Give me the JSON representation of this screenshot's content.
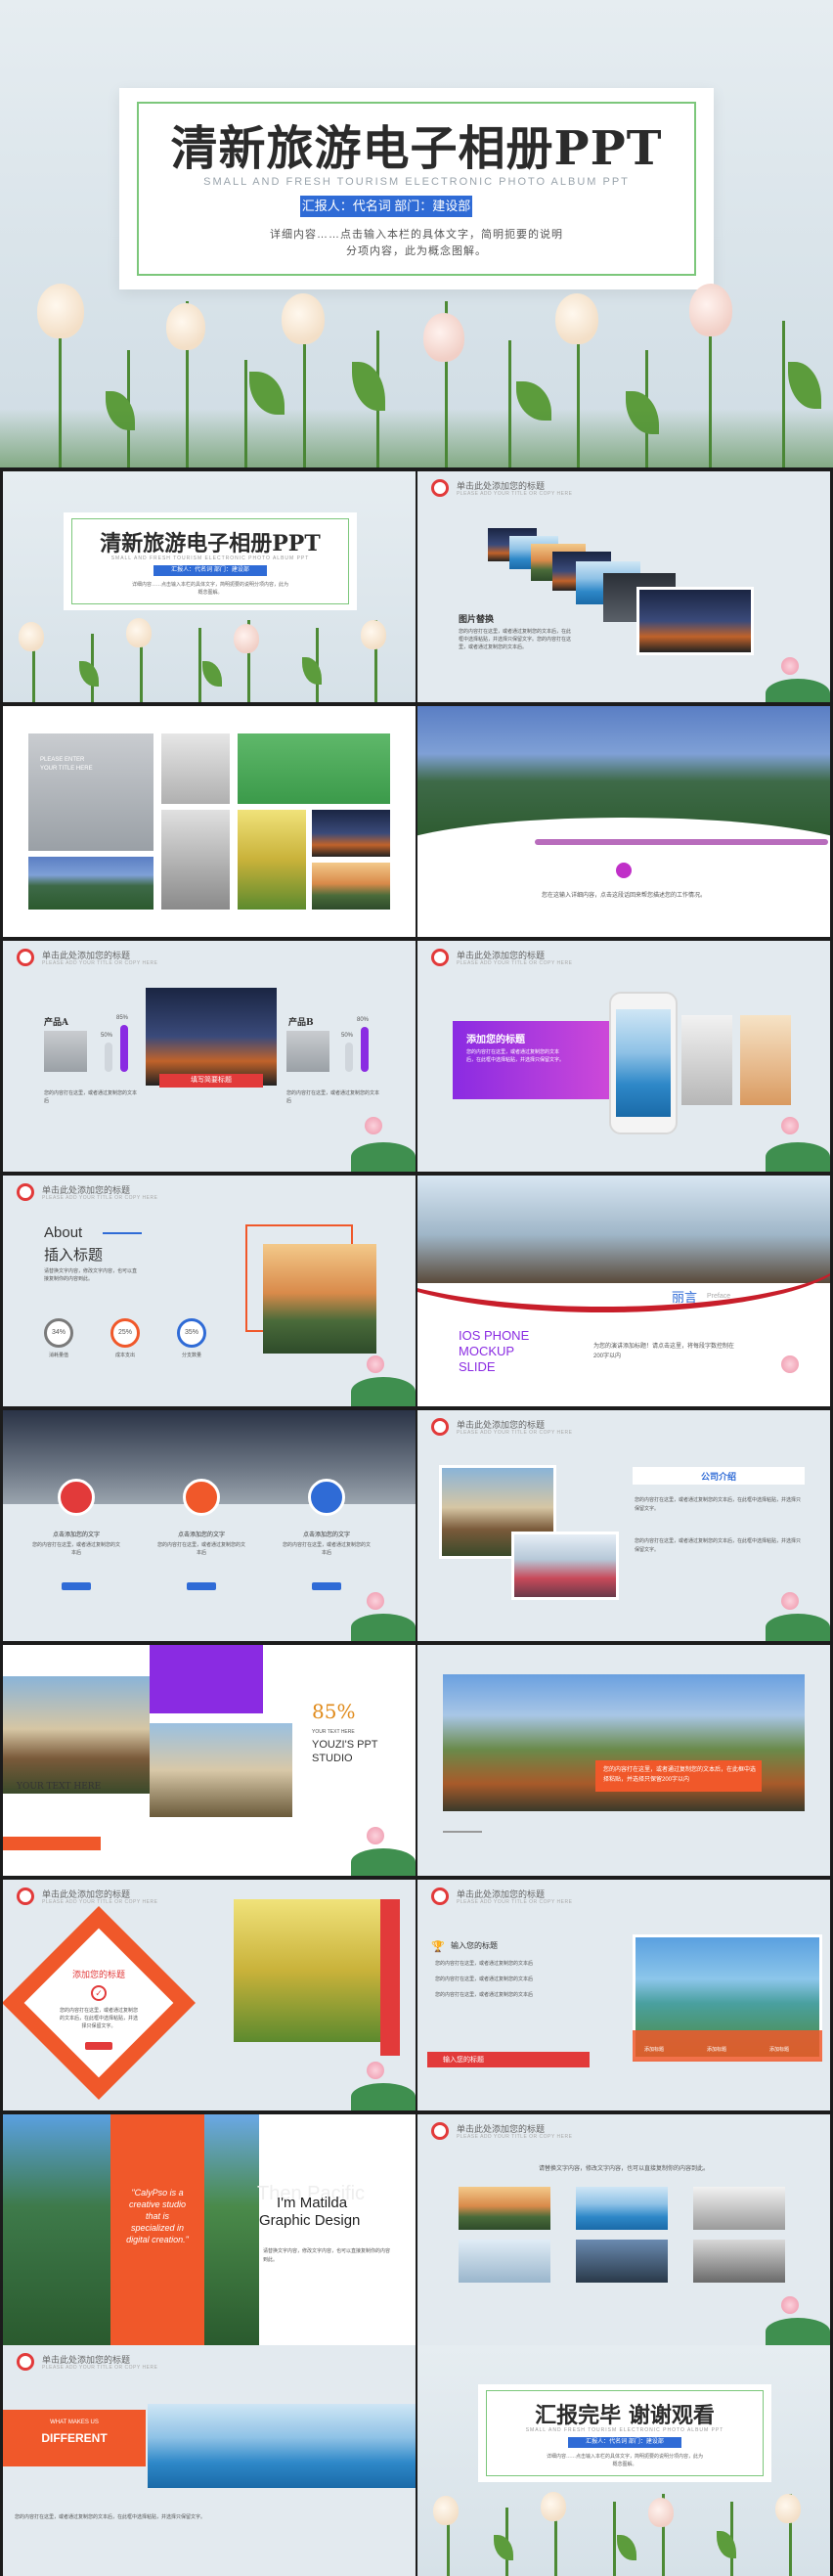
{
  "hero": {
    "title": "清新旅游电子相册PPT",
    "subtitle": "SMALL AND FRESH TOURISM ELECTRONIC PHOTO ALBUM PPT",
    "reporter": "汇报人：代名词 部门：建设部",
    "desc_line1": "详细内容……点击输入本栏的具体文字，简明扼要的说明",
    "desc_line2": "分项内容，此为概念图解。"
  },
  "common": {
    "header_title": "单击此处添加您的标题",
    "header_sub": "PLEASE ADD YOUR TITLE OR COPY HERE"
  },
  "s2": {
    "title": "清新旅游电子相册PPT",
    "subtitle": "SMALL AND FRESH TOURISM ELECTRONIC PHOTO ALBUM PPT",
    "reporter": "汇报人：代名词 部门：建设部",
    "desc": "详细内容……点击输入本栏的具体文字，简明扼要的说明分项内容，此为概念图解。"
  },
  "s3": {
    "label": "图片替换",
    "desc": "您的内容打在这里，或者通过复制您的文本后，在此框中选择粘贴，并选择只保留文字。您的内容打在这里，或者通过复制您的文本后。"
  },
  "s4": {
    "overlay_line1": "PLEASE ENTER",
    "overlay_line2": "YOUR TITLE HERE"
  },
  "s5": {
    "caption": "您在这输入详细内容，点击这段话回来帮您描述您的工作情况。"
  },
  "s6": {
    "product_a": "产品A",
    "product_b": "产品B",
    "pct_a1": "50%",
    "pct_a2": "85%",
    "pct_b1": "50%",
    "pct_b2": "80%",
    "center_label": "填写简要标题",
    "desc_a": "您的内容打在这里，或者通过复制您的文本后",
    "desc_b": "您的内容打在这里，或者通过复制您的文本后"
  },
  "s7": {
    "tag": "添加您的标题",
    "desc": "您的内容打在这里，或者通过复制您的文本后，在此框中选择粘贴，并选择只保留文字。"
  },
  "s8": {
    "about": "About",
    "heading": "插入标题",
    "desc": "请替换文字内容，修改文字内容，也可以直接复制你的内容到此。",
    "rings": [
      {
        "value": "34%",
        "label": "消耗量值"
      },
      {
        "value": "25%",
        "label": "成本支出"
      },
      {
        "value": "35%",
        "label": "分支数量"
      }
    ]
  },
  "s9": {
    "brand": "丽言",
    "brand_en": "Preface",
    "title_l1": "IOS PHONE",
    "title_l2": "MOCKUP",
    "title_l3": "SLIDE",
    "desc": "为您的演讲添加标题！请点击这里，将每段字数控制在200字以内"
  },
  "s10": {
    "items": [
      {
        "title": "点击添加您的文字",
        "desc": "您的内容打在这里，或者通过复制您的文本后"
      },
      {
        "title": "点击添加您的文字",
        "desc": "您的内容打在这里，或者通过复制您的文本后"
      },
      {
        "title": "点击添加您的文字",
        "desc": "您的内容打在这里，或者通过复制您的文本后"
      }
    ]
  },
  "s11": {
    "title": "公司介绍",
    "desc1": "您的内容打在这里，或者通过复制您的文本后，在此框中选择粘贴，并选择只保留文字。",
    "desc2": "您的内容打在这里，或者通过复制您的文本后，在此框中选择粘贴，并选择只保留文字。"
  },
  "s12": {
    "your_text": "YOUR TEXT HERE",
    "pct": "85%",
    "line1": "YOUR TEXT HERE",
    "line2": "YOUZI'S PPT",
    "line3": "STUDIO"
  },
  "s13": {
    "caption": "您的内容打在这里，或者通过复制您的文本后，在此框中选择粘贴，并选择只保留200字以内"
  },
  "s14": {
    "title": "添加您的标题",
    "desc": "您的内容打在这里，或者通过复制您的文本后，在此框中选择粘贴，并选择只保留文字。"
  },
  "s15": {
    "title": "输入您的标题",
    "bullets": [
      "您的内容打在这里，或者通过复制您的文本后",
      "您的内容打在这里，或者通过复制您的文本后",
      "您的内容打在这里，或者通过复制您的文本后"
    ],
    "red_bar": "输入您的标题",
    "icons": [
      "添加标题",
      "添加标题",
      "添加标题"
    ]
  },
  "s16": {
    "quote": "\"CalyPso is a creative studio that is specialized in digital creation.\"",
    "name": "I'm Matilda",
    "role": "Graphic Design",
    "ghost": "Then Pacific",
    "desc": "请替换文字内容，修改文字内容，也可以直接复制你的内容到此。"
  },
  "s17": {
    "caption": "请替换文字内容，修改文字内容，也可以直接复制你的内容到此。"
  },
  "s18": {
    "small": "WHAT MAKES US",
    "big": "DIFFERENT",
    "desc": "您的内容打在这里，或者通过复制您的文本后，在此框中选择粘贴，并选择只保留文字。"
  },
  "s19": {
    "title": "汇报完毕 谢谢观看",
    "subtitle": "SMALL AND FRESH TOURISM ELECTRONIC PHOTO ALBUM PPT",
    "reporter": "汇报人：代名词 部门：建设部",
    "desc": "详细内容……点击输入本栏的具体文字，简明扼要的说明分项内容，此为概念图解。"
  },
  "colors": {
    "accent_blue": "#2f6bd6",
    "accent_green": "#7cc77b",
    "accent_red": "#e23a3a",
    "accent_orange": "#f0582a",
    "accent_purple": "#8a2be2"
  }
}
